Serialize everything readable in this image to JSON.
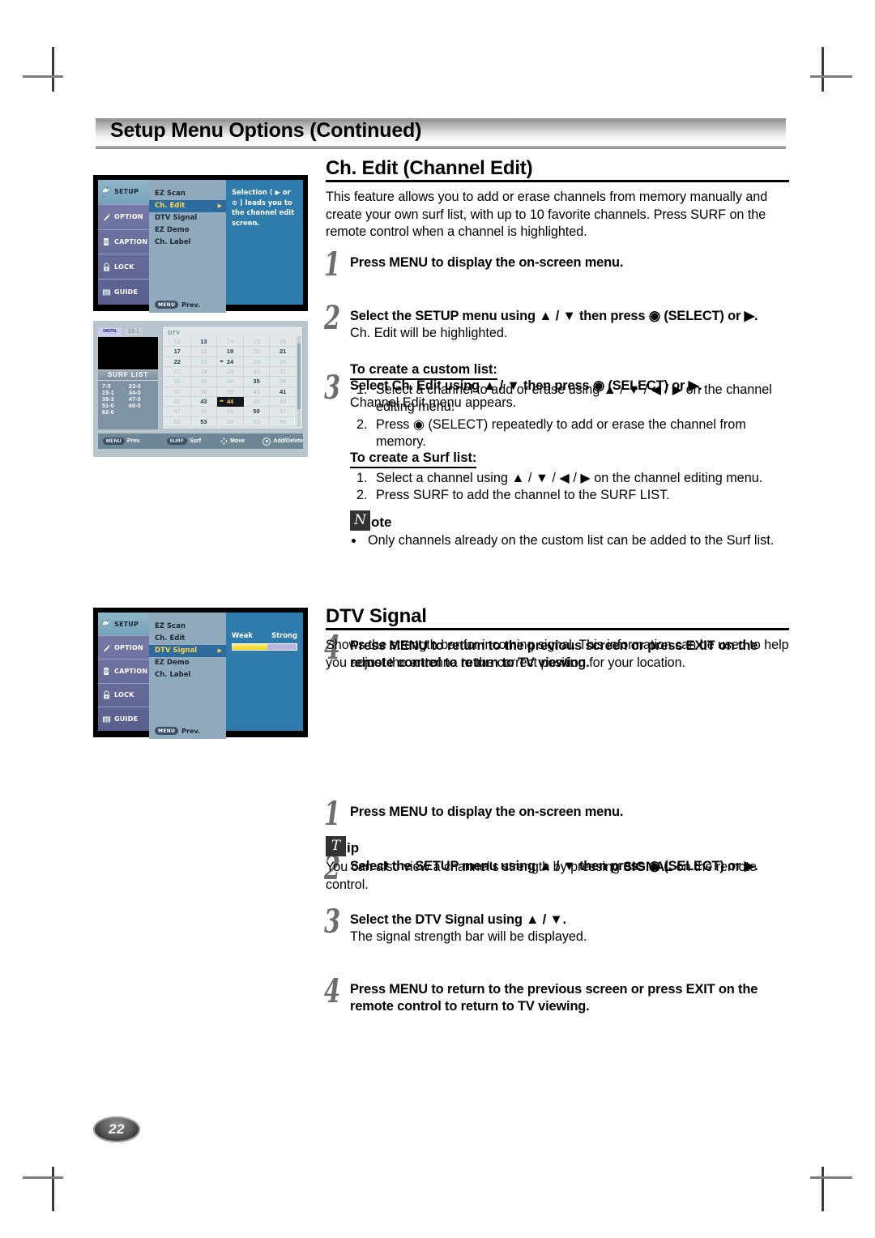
{
  "page": {
    "header_title": "Setup Menu Options (Continued)",
    "page_number": "22"
  },
  "ch_edit": {
    "heading": "Ch. Edit (Channel Edit)",
    "intro": "This feature allows you to add or erase channels from memory manually and create your own surf list, with up to 10 favorite channels. Press SURF on the remote control when a channel is highlighted.",
    "steps": [
      {
        "num": "1",
        "bold": "Press MENU to display the on-screen menu.",
        "sub": ""
      },
      {
        "num": "2",
        "bold": "Select the SETUP menu using ▲ / ▼ then press ◉ (SELECT) or ▶.",
        "sub": "Ch. Edit will be highlighted."
      },
      {
        "num": "3",
        "bold": "Select Ch. Edit using ▲ / ▼ then press ◉ (SELECT) or ▶.",
        "sub": "Channel Edit menu appears."
      }
    ],
    "custom_list_head": "To create a custom list:",
    "custom_list_items": [
      "Select a channel to add or erase using ▲ / ▼ / ◀ / ▶ on the channel editing menu.",
      "Press ◉ (SELECT) repeatedly to add or erase the channel from memory."
    ],
    "surf_list_head": "To create a Surf list:",
    "surf_list_items": [
      "Select a channel using ▲ / ▼ / ◀ / ▶ on the channel editing menu.",
      "Press SURF to add the channel to the SURF LIST."
    ],
    "note": {
      "glyph": "N",
      "word": "ote",
      "bullets": [
        "Only channels already on the custom list can be added to the Surf list."
      ]
    },
    "step4": {
      "num": "4",
      "line1": "Press MENU to return to the previous screen or press EXIT on the",
      "line2": "remote control to return to TV viewing."
    }
  },
  "dtv_signal": {
    "heading": "DTV Signal",
    "intro": "Shows the strength bar for incoming signal. This information can be used to help you adjust the antenna to the correct position for your location.",
    "steps": [
      {
        "num": "1",
        "bold": "Press MENU to display the on-screen menu.",
        "sub": ""
      },
      {
        "num": "2",
        "bold": "Select the SETUP menu using ▲ / ▼ then press ◉ (SELECT) or ▶.",
        "sub": ""
      },
      {
        "num": "3",
        "bold": "Select the DTV Signal using ▲ / ▼.",
        "sub": "The signal strength bar will be displayed."
      }
    ],
    "step4": {
      "num": "4",
      "line1": "Press MENU to return to the previous screen or press EXIT on the",
      "line2": "remote control to return to TV viewing."
    },
    "tip": {
      "glyph": "T",
      "word": "ip",
      "text_before": "You can also view a channel’s strength by pressing ",
      "text_bold": "SIGNAL",
      "text_after": " on the remote control."
    }
  },
  "osd_setup": {
    "sidebar": [
      {
        "label": "SETUP",
        "icon": "satellite-dish-icon",
        "active": true
      },
      {
        "label": "OPTION",
        "icon": "pen-tag-icon",
        "active": false
      },
      {
        "label": "CAPTION",
        "icon": "caption-card-icon",
        "active": false
      },
      {
        "label": "LOCK",
        "icon": "padlock-icon",
        "active": false
      },
      {
        "label": "GUIDE",
        "icon": "guide-book-icon",
        "active": false
      }
    ],
    "menu_items": [
      {
        "label": "EZ Scan",
        "active": false
      },
      {
        "label": "Ch. Edit",
        "active": true
      },
      {
        "label": "DTV Signal",
        "active": false
      },
      {
        "label": "EZ Demo",
        "active": false
      },
      {
        "label": "Ch. Label",
        "active": false
      }
    ],
    "prev_key": "MENU",
    "prev_label": "Prev.",
    "panel_text": "Selection ( ▶ or ⊙ ) leads you to the channel edit screen."
  },
  "osd_dtv": {
    "sidebar": [
      {
        "label": "SETUP",
        "icon": "satellite-dish-icon",
        "active": true
      },
      {
        "label": "OPTION",
        "icon": "pen-tag-icon",
        "active": false
      },
      {
        "label": "CAPTION",
        "icon": "caption-card-icon",
        "active": false
      },
      {
        "label": "LOCK",
        "icon": "padlock-icon",
        "active": false
      },
      {
        "label": "GUIDE",
        "icon": "guide-book-icon",
        "active": false
      }
    ],
    "menu_items": [
      {
        "label": "EZ Scan",
        "active": false
      },
      {
        "label": "Ch. Edit",
        "active": false
      },
      {
        "label": "DTV Signal",
        "active": true
      },
      {
        "label": "EZ Demo",
        "active": false
      },
      {
        "label": "Ch. Label",
        "active": false
      }
    ],
    "prev_key": "MENU",
    "prev_label": "Prev.",
    "signal": {
      "weak_label": "Weak",
      "strong_label": "Strong",
      "level_percent": 55
    }
  },
  "osd_channel_edit": {
    "logo_text": "DIGITAL",
    "channel_label": "23-1",
    "source_label": "DTV",
    "surf_list_title": "SURF LIST",
    "surf_list": [
      "7-0",
      "23-0",
      "23-1",
      "34-0",
      "39-3",
      "47-0",
      "51-0",
      "60-0",
      "62-0"
    ],
    "grid": [
      {
        "n": "12",
        "state": "dim"
      },
      {
        "n": "13",
        "state": "bold"
      },
      {
        "n": "14",
        "state": "dim"
      },
      {
        "n": "15",
        "state": "dim"
      },
      {
        "n": "16",
        "state": "dim"
      },
      {
        "n": "17",
        "state": "bold"
      },
      {
        "n": "18",
        "state": "dim"
      },
      {
        "n": "19",
        "state": "bold"
      },
      {
        "n": "20",
        "state": "dim"
      },
      {
        "n": "21",
        "state": "bold"
      },
      {
        "n": "22",
        "state": "bold"
      },
      {
        "n": "23",
        "state": "dim"
      },
      {
        "n": "24",
        "state": "bold-pen"
      },
      {
        "n": "25",
        "state": "dim"
      },
      {
        "n": "26",
        "state": "dim"
      },
      {
        "n": "27",
        "state": "dim"
      },
      {
        "n": "28",
        "state": "dim"
      },
      {
        "n": "29",
        "state": "dim"
      },
      {
        "n": "30",
        "state": "dim"
      },
      {
        "n": "31",
        "state": "dim"
      },
      {
        "n": "32",
        "state": "dim"
      },
      {
        "n": "33",
        "state": "dim"
      },
      {
        "n": "34",
        "state": "dim"
      },
      {
        "n": "35",
        "state": "bold"
      },
      {
        "n": "36",
        "state": "dim"
      },
      {
        "n": "37",
        "state": "dim"
      },
      {
        "n": "38",
        "state": "dim"
      },
      {
        "n": "39",
        "state": "dim"
      },
      {
        "n": "40",
        "state": "dim"
      },
      {
        "n": "41",
        "state": "bold"
      },
      {
        "n": "42",
        "state": "dim"
      },
      {
        "n": "43",
        "state": "bold"
      },
      {
        "n": "44",
        "state": "selected-pen"
      },
      {
        "n": "45",
        "state": "dim"
      },
      {
        "n": "46",
        "state": "dim"
      },
      {
        "n": "47",
        "state": "dim"
      },
      {
        "n": "48",
        "state": "dim"
      },
      {
        "n": "49",
        "state": "dim"
      },
      {
        "n": "50",
        "state": "bold"
      },
      {
        "n": "51",
        "state": "dim"
      },
      {
        "n": "52",
        "state": "dim"
      },
      {
        "n": "53",
        "state": "bold"
      },
      {
        "n": "54",
        "state": "dim"
      },
      {
        "n": "55",
        "state": "dim"
      },
      {
        "n": "56",
        "state": "dim"
      }
    ],
    "footer": [
      {
        "key": "MENU",
        "label": "Prev."
      },
      {
        "key": "SURF",
        "label": "Surf"
      },
      {
        "key": "",
        "label": "Move"
      },
      {
        "key": "",
        "label": "Add/Delete"
      }
    ]
  }
}
